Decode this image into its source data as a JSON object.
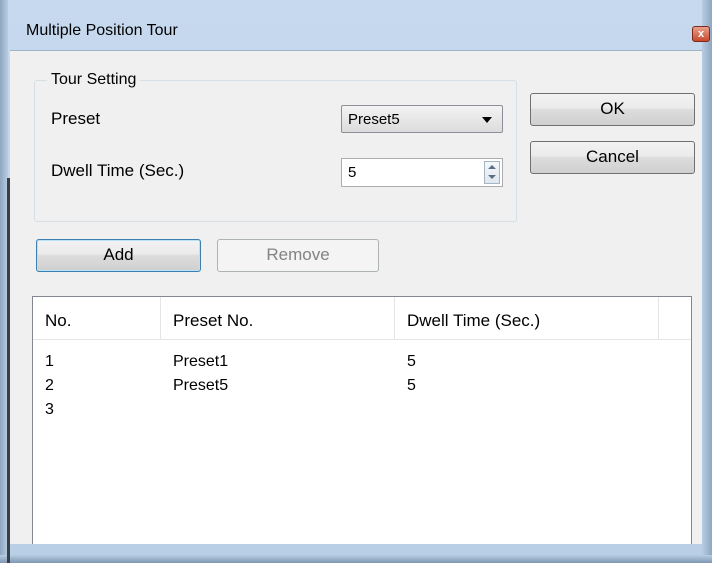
{
  "window": {
    "title": "Multiple Position Tour",
    "close_label": "x"
  },
  "tour_setting": {
    "group_label": "Tour Setting",
    "preset_label": "Preset",
    "preset_value": "Preset5",
    "dwell_label": "Dwell Time (Sec.)",
    "dwell_value": "5"
  },
  "buttons": {
    "ok": "OK",
    "cancel": "Cancel",
    "add": "Add",
    "remove": "Remove"
  },
  "list": {
    "columns": [
      "No.",
      "Preset No.",
      "Dwell Time (Sec.)"
    ],
    "rows": [
      {
        "no": "1",
        "preset": "Preset1",
        "dwell": "5"
      },
      {
        "no": "2",
        "preset": "Preset5",
        "dwell": "5"
      },
      {
        "no": "3",
        "preset": "",
        "dwell": ""
      }
    ]
  }
}
